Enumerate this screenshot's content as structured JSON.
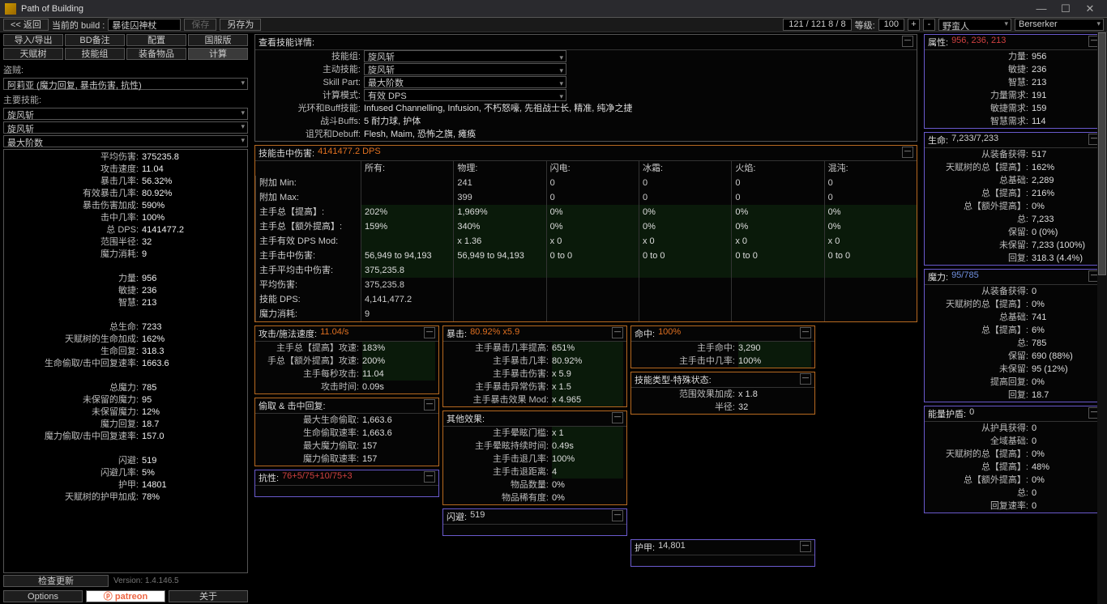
{
  "window": {
    "title": "Path of Building",
    "min": "—",
    "max": "☐",
    "close": "✕"
  },
  "toolbar": {
    "back": "<< 返回",
    "current": "当前的 build :",
    "build_name": "暴徒囚神杖",
    "save": "保存",
    "save_as": "另存为",
    "points": "121 / 121   8 / 8",
    "level_lbl": "等级:",
    "level": "100",
    "plus": "+",
    "minus": "-",
    "class": "野蛮人",
    "asc": "Berserker"
  },
  "left": {
    "tabs1": [
      "导入/导出",
      "BD备注",
      "配置",
      "国服版"
    ],
    "tabs2": [
      "天赋树",
      "技能组",
      "装备物品",
      "计算"
    ],
    "bandit_lbl": "盗贼:",
    "bandit": "阿莉亚 (魔力回复, 暴击伤害, 抗性)",
    "main_skill_lbl": "主要技能:",
    "main_skill": "旋风斩",
    "main_skill2": "旋风斩",
    "skill_part": "最大阶数",
    "stats": [
      {
        "k": "平均伤害:",
        "v": "375235.8"
      },
      {
        "k": "攻击速度:",
        "v": "11.04"
      },
      {
        "k": "暴击几率:",
        "v": "56.32%"
      },
      {
        "k": "有效暴击几率:",
        "v": "80.92%"
      },
      {
        "k": "暴击伤害加成:",
        "v": "590%"
      },
      {
        "k": "击中几率:",
        "v": "100%"
      },
      {
        "k": "总 DPS:",
        "v": "4141477.2"
      },
      {
        "k": "范围半径:",
        "v": "32"
      },
      {
        "k": "魔力消耗:",
        "v": "9"
      },
      {
        "k": "",
        "v": ""
      },
      {
        "k": "力量:",
        "v": "956"
      },
      {
        "k": "敏捷:",
        "v": "236"
      },
      {
        "k": "智慧:",
        "v": "213"
      },
      {
        "k": "",
        "v": ""
      },
      {
        "k": "总生命:",
        "v": "7233"
      },
      {
        "k": "天赋树的生命加成:",
        "v": "162%"
      },
      {
        "k": "生命回复:",
        "v": "318.3"
      },
      {
        "k": "生命偷取/击中回复速率:",
        "v": "1663.6"
      },
      {
        "k": "",
        "v": ""
      },
      {
        "k": "总魔力:",
        "v": "785"
      },
      {
        "k": "未保留的魔力:",
        "v": "95"
      },
      {
        "k": "未保留魔力:",
        "v": "12%"
      },
      {
        "k": "魔力回复:",
        "v": "18.7"
      },
      {
        "k": "魔力偷取/击中回复速率:",
        "v": "157.0"
      },
      {
        "k": "",
        "v": ""
      },
      {
        "k": "闪避:",
        "v": "519"
      },
      {
        "k": "闪避几率:",
        "v": "5%"
      },
      {
        "k": "护甲:",
        "v": "14801"
      },
      {
        "k": "天赋树的护甲加成:",
        "v": "78%"
      }
    ],
    "check_update": "检查更新",
    "version": "Version: 1.4.146.5",
    "options": "Options",
    "patreon": "ⓟ patreon",
    "about": "关于"
  },
  "detail": {
    "header": "查看技能详情:",
    "rows": [
      {
        "k": "技能组:",
        "v": "旋风斩",
        "dd": true
      },
      {
        "k": "主动技能:",
        "v": "旋风斩",
        "dd": true
      },
      {
        "k": "Skill Part:",
        "v": "最大阶数",
        "dd": true
      },
      {
        "k": "计算模式:",
        "v": "有效 DPS",
        "dd": true
      },
      {
        "k": "光环和Buff技能:",
        "v": "Infused Channelling, Infusion, 不朽怒嚎, 先祖战士长, 精准, 纯净之捷"
      },
      {
        "k": "战斗Buffs:",
        "v": "5 耐力球, 护体"
      },
      {
        "k": "诅咒和Debuff:",
        "v": "Flesh, Maim, 恐怖之旗, 瘫痪"
      }
    ]
  },
  "hit": {
    "title": "技能击中伤害:",
    "value": "4141477.2 DPS",
    "cols": [
      "",
      "所有:",
      "物理:",
      "闪电:",
      "冰霜:",
      "火焰:",
      "混沌:"
    ],
    "rows": [
      {
        "k": "附加 Min:",
        "c": [
          "",
          "241",
          "0",
          "0",
          "0",
          "0"
        ]
      },
      {
        "k": "附加 Max:",
        "c": [
          "",
          "399",
          "0",
          "0",
          "0",
          "0"
        ]
      },
      {
        "k": "主手总【提高】:",
        "c": [
          "202%",
          "1,969%",
          "0%",
          "0%",
          "0%",
          "0%"
        ],
        "g": true
      },
      {
        "k": "主手总【额外提高】:",
        "c": [
          "159%",
          "340%",
          "0%",
          "0%",
          "0%",
          "0%"
        ],
        "g": true
      },
      {
        "k": "主手有效 DPS Mod:",
        "c": [
          "",
          "x 1.36",
          "x 0",
          "x 0",
          "x 0",
          "x 0"
        ],
        "g": true
      },
      {
        "k": "主手击中伤害:",
        "c": [
          "56,949 to 94,193",
          "56,949 to 94,193",
          "0 to 0",
          "0 to 0",
          "0 to 0",
          "0 to 0"
        ],
        "g": true
      },
      {
        "k": "主手平均击中伤害:",
        "c": [
          "375,235.8",
          "",
          "",
          "",
          "",
          ""
        ],
        "g": true
      },
      {
        "k": "平均伤害:",
        "c": [
          "375,235.8",
          "",
          "",
          "",
          "",
          ""
        ]
      },
      {
        "k": "技能 DPS:",
        "c": [
          "4,141,477.2",
          "",
          "",
          "",
          "",
          ""
        ]
      },
      {
        "k": "魔力消耗:",
        "c": [
          "9",
          "",
          "",
          "",
          "",
          ""
        ]
      }
    ]
  },
  "speed": {
    "title": "攻击/施法速度:",
    "value": "11.04/s",
    "rows": [
      {
        "k": "主手总【提高】攻速:",
        "v": "183%",
        "g": true
      },
      {
        "k": "手总【额外提高】攻速:",
        "v": "200%",
        "g": true
      },
      {
        "k": "主手每秒攻击:",
        "v": "11.04",
        "g": true
      },
      {
        "k": "攻击时间:",
        "v": "0.09s"
      }
    ]
  },
  "crit": {
    "title": "暴击:",
    "value": "80.92% x5.9",
    "rows": [
      {
        "k": "主手暴击几率提高:",
        "v": "651%",
        "g": true
      },
      {
        "k": "主手暴击几率:",
        "v": "80.92%",
        "g": true
      },
      {
        "k": "主手暴击伤害:",
        "v": "x 5.9",
        "g": true
      },
      {
        "k": "主手暴击异常伤害:",
        "v": "x 1.5",
        "g": true
      },
      {
        "k": "主手暴击效果 Mod:",
        "v": "x 4.965",
        "g": true
      }
    ]
  },
  "acc": {
    "title": "命中:",
    "value": "100%",
    "rows": [
      {
        "k": "主手命中:",
        "v": "3,290",
        "g": true
      },
      {
        "k": "主手击中几率:",
        "v": "100%",
        "g": true
      }
    ]
  },
  "special": {
    "title": "技能类型-特殊状态:",
    "rows": [
      {
        "k": "范围效果加成:",
        "v": "x 1.8"
      },
      {
        "k": "半径:",
        "v": "32"
      }
    ]
  },
  "leech": {
    "title": "偷取 & 击中回复:",
    "rows": [
      {
        "k": "最大生命偷取:",
        "v": "1,663.6"
      },
      {
        "k": "生命偷取速率:",
        "v": "1,663.6"
      },
      {
        "k": "最大魔力偷取:",
        "v": "157"
      },
      {
        "k": "魔力偷取速率:",
        "v": "157"
      }
    ]
  },
  "other": {
    "title": "其他效果:",
    "rows": [
      {
        "k": "主手晕眩门槛:",
        "v": "x 1",
        "g": true
      },
      {
        "k": "主手晕眩持续时间:",
        "v": "0.49s",
        "g": true
      },
      {
        "k": "主手击退几率:",
        "v": "100%",
        "g": true
      },
      {
        "k": "主手击退距离:",
        "v": "4",
        "g": true
      },
      {
        "k": "物品数量:",
        "v": "0%"
      },
      {
        "k": "物品稀有度:",
        "v": "0%"
      }
    ]
  },
  "res": {
    "title": "抗性:",
    "value": "76+5/75+10/75+3"
  },
  "evasion": {
    "title": "闪避:",
    "value": "519"
  },
  "armour": {
    "title": "护甲:",
    "value": "14,801"
  },
  "attrs": {
    "title": "属性:",
    "value": "956, 236, 213",
    "rows": [
      {
        "k": "力量:",
        "v": "956"
      },
      {
        "k": "敏捷:",
        "v": "236"
      },
      {
        "k": "智慧:",
        "v": "213"
      },
      {
        "k": "力量需求:",
        "v": "191"
      },
      {
        "k": "敏捷需求:",
        "v": "159"
      },
      {
        "k": "智慧需求:",
        "v": "114"
      }
    ]
  },
  "life": {
    "title": "生命:",
    "value": "7,233/7,233",
    "rows": [
      {
        "k": "从装备获得:",
        "v": "517"
      },
      {
        "k": "天赋树的总【提高】:",
        "v": "162%"
      },
      {
        "k": "总基础:",
        "v": "2,289"
      },
      {
        "k": "总【提高】:",
        "v": "216%"
      },
      {
        "k": "总【额外提高】:",
        "v": "0%"
      },
      {
        "k": "总:",
        "v": "7,233"
      },
      {
        "k": "保留:",
        "v": "0 (0%)"
      },
      {
        "k": "未保留:",
        "v": "7,233 (100%)"
      },
      {
        "k": "回复:",
        "v": "318.3 (4.4%)"
      }
    ]
  },
  "mana": {
    "title": "魔力:",
    "value": "95/785",
    "rows": [
      {
        "k": "从装备获得:",
        "v": "0"
      },
      {
        "k": "天赋树的总【提高】:",
        "v": "0%"
      },
      {
        "k": "总基础:",
        "v": "741"
      },
      {
        "k": "总【提高】:",
        "v": "6%"
      },
      {
        "k": "总:",
        "v": "785"
      },
      {
        "k": "保留:",
        "v": "690 (88%)"
      },
      {
        "k": "未保留:",
        "v": "95 (12%)"
      },
      {
        "k": "提高回复:",
        "v": "0%"
      },
      {
        "k": "回复:",
        "v": "18.7"
      }
    ]
  },
  "es": {
    "title": "能量护盾:",
    "value": "0",
    "rows": [
      {
        "k": "从护具获得:",
        "v": "0"
      },
      {
        "k": "全域基础:",
        "v": "0"
      },
      {
        "k": "天赋树的总【提高】:",
        "v": "0%"
      },
      {
        "k": "总【提高】:",
        "v": "48%"
      },
      {
        "k": "总【额外提高】:",
        "v": "0%"
      },
      {
        "k": "总:",
        "v": "0"
      },
      {
        "k": "回复速率:",
        "v": "0"
      }
    ]
  }
}
